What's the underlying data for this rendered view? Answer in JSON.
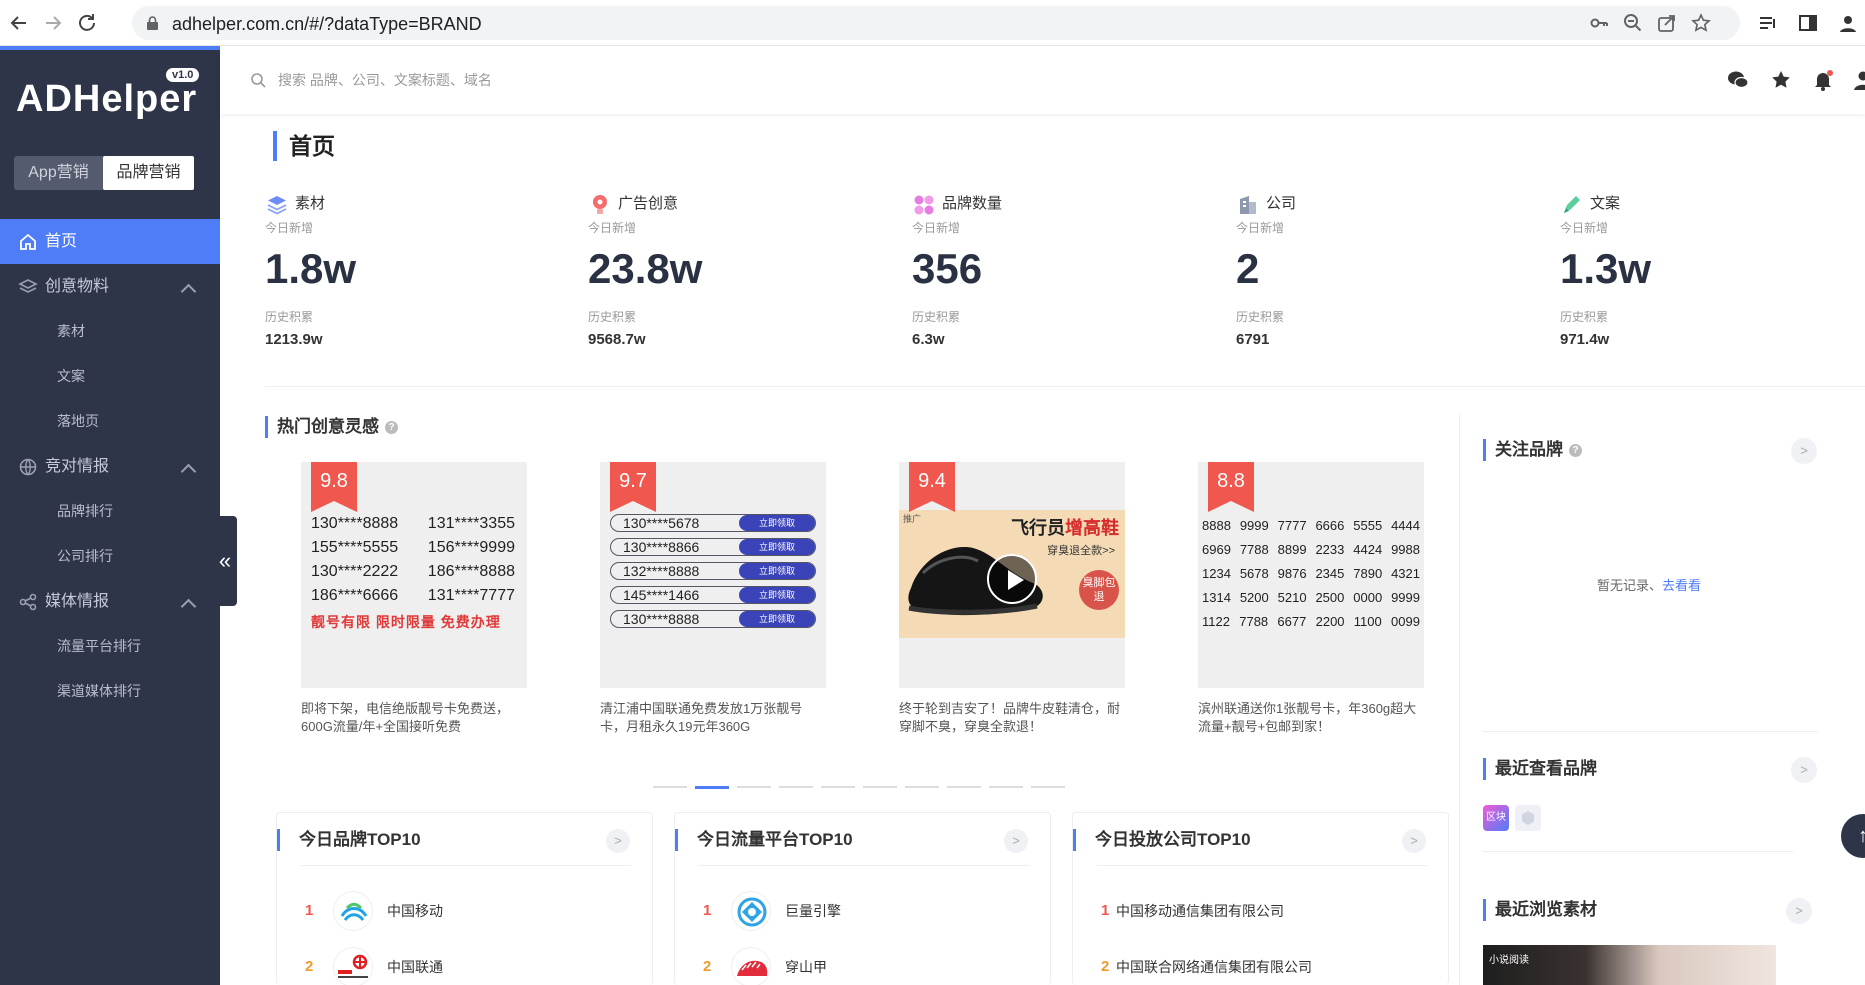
{
  "browser": {
    "url": "adhelper.com.cn/#/?dataType=BRAND"
  },
  "sidebar": {
    "logo": "ADHelper",
    "version": "v1.0",
    "switch": {
      "app": "App营销",
      "brand": "品牌营销"
    },
    "menu": {
      "home": "首页",
      "creative": "创意物料",
      "material": "素材",
      "copy": "文案",
      "landing": "落地页",
      "competitive": "竞对情报",
      "brand_rank": "品牌排行",
      "company_rank": "公司排行",
      "media": "媒体情报",
      "traffic_rank": "流量平台排行",
      "channel_rank": "渠道媒体排行"
    }
  },
  "topbar": {
    "search_placeholder": "搜索 品牌、公司、文案标题、域名"
  },
  "page": {
    "title": "首页"
  },
  "stats": {
    "today_label": "今日新增",
    "history_label": "历史积累",
    "items": [
      {
        "name": "素材",
        "today": "1.8w",
        "history": "1213.9w",
        "icon": "layers-icon"
      },
      {
        "name": "广告创意",
        "today": "23.8w",
        "history": "9568.7w",
        "icon": "bulb-icon"
      },
      {
        "name": "品牌数量",
        "today": "356",
        "history": "6.3w",
        "icon": "grid-dots-icon"
      },
      {
        "name": "公司",
        "today": "2",
        "history": "6791",
        "icon": "building-icon"
      },
      {
        "name": "文案",
        "today": "1.3w",
        "history": "971.4w",
        "icon": "pen-icon"
      }
    ]
  },
  "hot": {
    "title": "热门创意灵感",
    "cards": [
      {
        "score": "9.8",
        "rows": [
          [
            "130****8888",
            "131****3355"
          ],
          [
            "155****5555",
            "156****9999"
          ],
          [
            "130****2222",
            "186****8888"
          ],
          [
            "186****6666",
            "131****7777"
          ]
        ],
        "slogan": "靓号有限  限时限量  免费办理",
        "desc": "即将下架，电信绝版靓号卡免费送，600G流量/年+全国接听免费"
      },
      {
        "score": "9.7",
        "pills": [
          "130****5678",
          "130****8866",
          "132****8888",
          "145****1466",
          "130****8888"
        ],
        "pill_btn": "立即领取",
        "desc": "清江浦中国联通免费发放1万张靓号卡，月租永久19元年360G"
      },
      {
        "score": "9.4",
        "headline_a": "飞行员",
        "headline_b": "增高鞋",
        "subline": "穿臭退全款>>",
        "badge": "臭脚包退",
        "corner": "推广",
        "desc": "终于轮到吉安了！品牌牛皮鞋清仓，耐穿脚不臭，穿臭全款退！"
      },
      {
        "score": "8.8",
        "rows": [
          [
            "8888",
            "9999",
            "7777",
            "6666",
            "5555",
            "4444"
          ],
          [
            "6969",
            "7788",
            "8899",
            "2233",
            "4424",
            "9988"
          ],
          [
            "1234",
            "5678",
            "9876",
            "2345",
            "7890",
            "4321"
          ],
          [
            "1314",
            "5200",
            "5210",
            "2500",
            "0000",
            "9999"
          ],
          [
            "1122",
            "7788",
            "6677",
            "2200",
            "1100",
            "0099"
          ]
        ],
        "desc": "滨州联通送你1张靓号卡，年360g超大流量+靓号+包邮到家！"
      }
    ]
  },
  "ranks": {
    "brand": {
      "title": "今日品牌TOP10",
      "rows": [
        {
          "n": "1",
          "name": "中国移动"
        },
        {
          "n": "2",
          "name": "中国联通"
        }
      ]
    },
    "traffic": {
      "title": "今日流量平台TOP10",
      "rows": [
        {
          "n": "1",
          "name": "巨量引擎"
        },
        {
          "n": "2",
          "name": "穿山甲"
        }
      ]
    },
    "company": {
      "title": "今日投放公司TOP10",
      "rows": [
        {
          "n": "1",
          "name": "中国移动通信集团有限公司"
        },
        {
          "n": "2",
          "name": "中国联合网络通信集团有限公司"
        }
      ]
    }
  },
  "side": {
    "follow_title": "关注品牌",
    "empty_text": "暂无记录、",
    "empty_link": "去看看",
    "recent_title": "最近查看品牌",
    "recent_logo_text": "区块",
    "browse_title": "最近浏览素材",
    "browse_thumb_text": "小说阅读"
  },
  "colors": {
    "accent": "#4f7cf7",
    "sidebar": "#2f3549",
    "score": "#f0574e"
  }
}
